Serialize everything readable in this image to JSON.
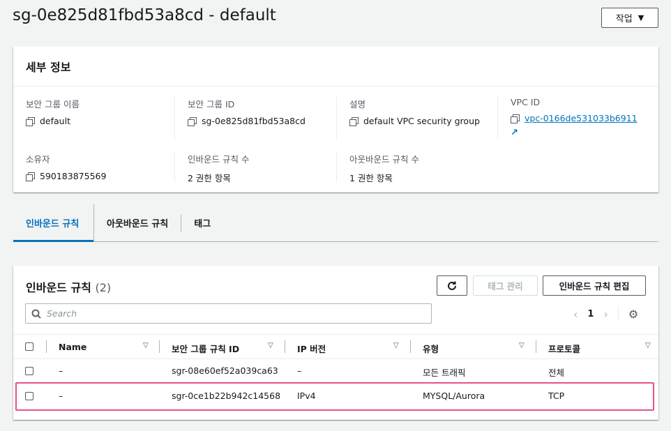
{
  "page": {
    "title": "sg-0e825d81fbd53a8cd - default",
    "actions_label": "작업"
  },
  "details": {
    "header": "세부 정보",
    "fields": [
      {
        "label": "보안 그룹 이름",
        "value": "default"
      },
      {
        "label": "보안 그룹 ID",
        "value": "sg-0e825d81fbd53a8cd"
      },
      {
        "label": "설명",
        "value": "default VPC security group"
      },
      {
        "label": "VPC ID",
        "value": "vpc-0166de531033b6911"
      },
      {
        "label": "소유자",
        "value": "590183875569"
      },
      {
        "label": "인바운드 규칙 수",
        "value": "2 권한 항목"
      },
      {
        "label": "아웃바운드 규칙 수",
        "value": "1 권한 항목"
      }
    ]
  },
  "tabs": [
    "인바운드 규칙",
    "아웃바운드 규칙",
    "태그"
  ],
  "rules": {
    "title": "인바운드 규칙",
    "count": "(2)",
    "tag_manage_label": "태그 관리",
    "edit_label": "인바운드 규칙 편집",
    "search_placeholder": "Search",
    "page_number": "1",
    "columns": [
      "Name",
      "보안 그룹 규칙 ID",
      "IP 버전",
      "유형",
      "프로토콜"
    ],
    "rows": [
      {
        "name": "–",
        "rule_id": "sgr-08e60ef52a039ca63",
        "ip_version": "–",
        "type": "모든 트래픽",
        "protocol": "전체"
      },
      {
        "name": "–",
        "rule_id": "sgr-0ce1b22b942c14568",
        "ip_version": "IPv4",
        "type": "MYSQL/Aurora",
        "protocol": "TCP"
      }
    ]
  },
  "colors": {
    "link": "#0073bb",
    "highlight": "#e7508f"
  }
}
